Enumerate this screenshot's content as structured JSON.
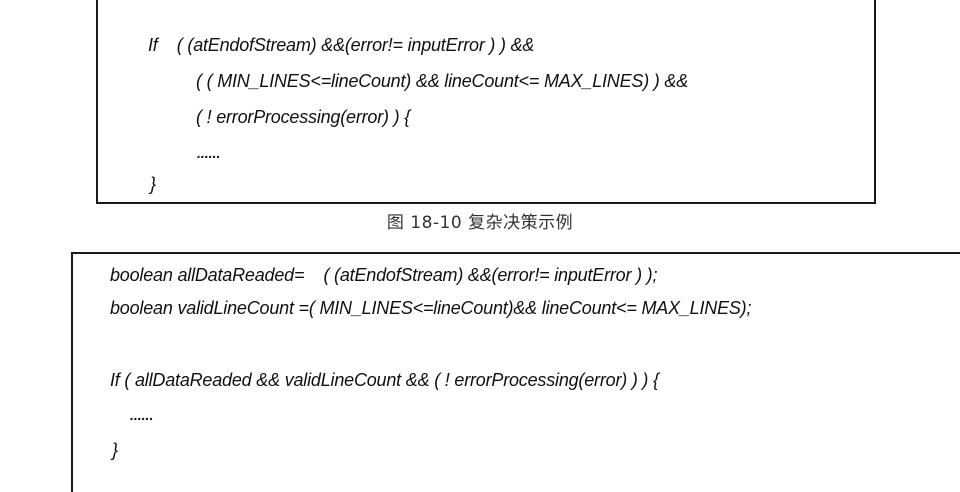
{
  "figure1": {
    "lines": [
      "If    ( (atEndofStream) &&(error!= inputError ) ) &&",
      "( ( MIN_LINES<=lineCount) && lineCount<= MAX_LINES) ) &&",
      "( ! errorProcessing(error) ) {",
      "......",
      "}"
    ],
    "caption": "图 18-10  复杂决策示例"
  },
  "figure2": {
    "lines": [
      "boolean allDataReaded=    ( (atEndofStream) &&(error!= inputError ) );",
      "boolean validLineCount =( MIN_LINES<=lineCount)&& lineCount<= MAX_LINES);",
      "If ( allDataReaded && validLineCount && ( ! errorProcessing(error) ) ) {",
      "......",
      "}"
    ]
  }
}
